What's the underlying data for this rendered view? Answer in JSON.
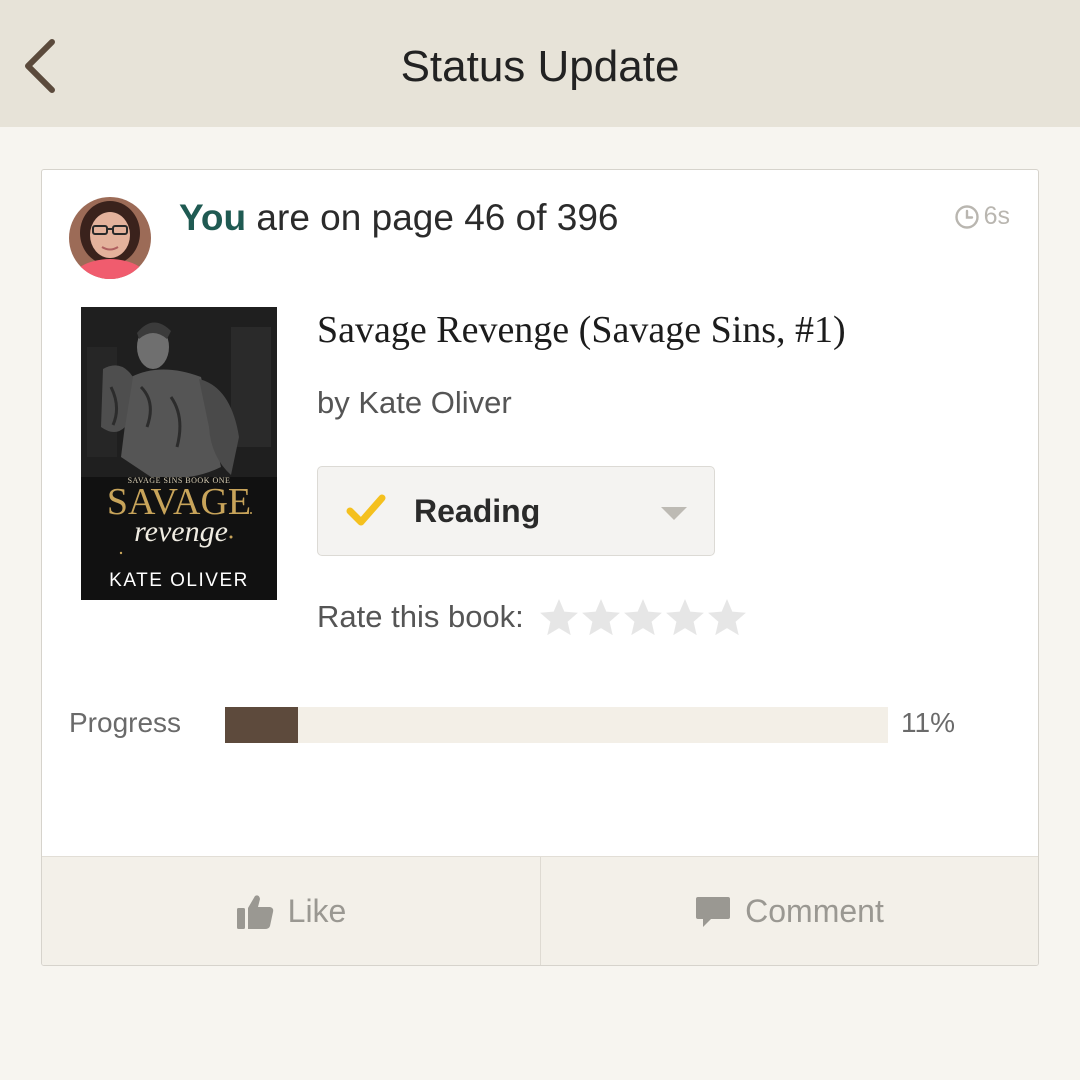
{
  "header": {
    "title": "Status Update",
    "back_icon": "chevron-left-icon"
  },
  "status": {
    "you_label": "You",
    "text": "are on page 46 of 396",
    "current_page": 46,
    "total_pages": 396,
    "timestamp": "6s",
    "timestamp_icon": "clock-icon"
  },
  "book": {
    "title": "Savage Revenge (Savage Sins, #1)",
    "author_prefix": "by",
    "author": "Kate Oliver",
    "cover": {
      "series_line": "SAVAGE SINS BOOK ONE",
      "title_main": "SAVAGE",
      "title_script": "revenge",
      "author": "KATE OLIVER"
    }
  },
  "shelf": {
    "label": "Reading",
    "check_icon": "checkmark-icon",
    "dropdown_icon": "caret-down-icon"
  },
  "rating": {
    "label": "Rate this book:",
    "max_stars": 5,
    "current": 0
  },
  "progress": {
    "label": "Progress",
    "percent_text": "11%",
    "fraction": 0.11
  },
  "actions": {
    "like_label": "Like",
    "like_icon": "thumbs-up-icon",
    "comment_label": "Comment",
    "comment_icon": "speech-bubble-icon"
  },
  "colors": {
    "header_bg": "#e7e3d8",
    "page_bg": "#f7f5f0",
    "you_link": "#1f5a52",
    "progress_fill": "#5d4a3c",
    "progress_track": "#f3efe7",
    "check_yellow": "#f4c01e",
    "cover_gold": "#c8a45a"
  }
}
